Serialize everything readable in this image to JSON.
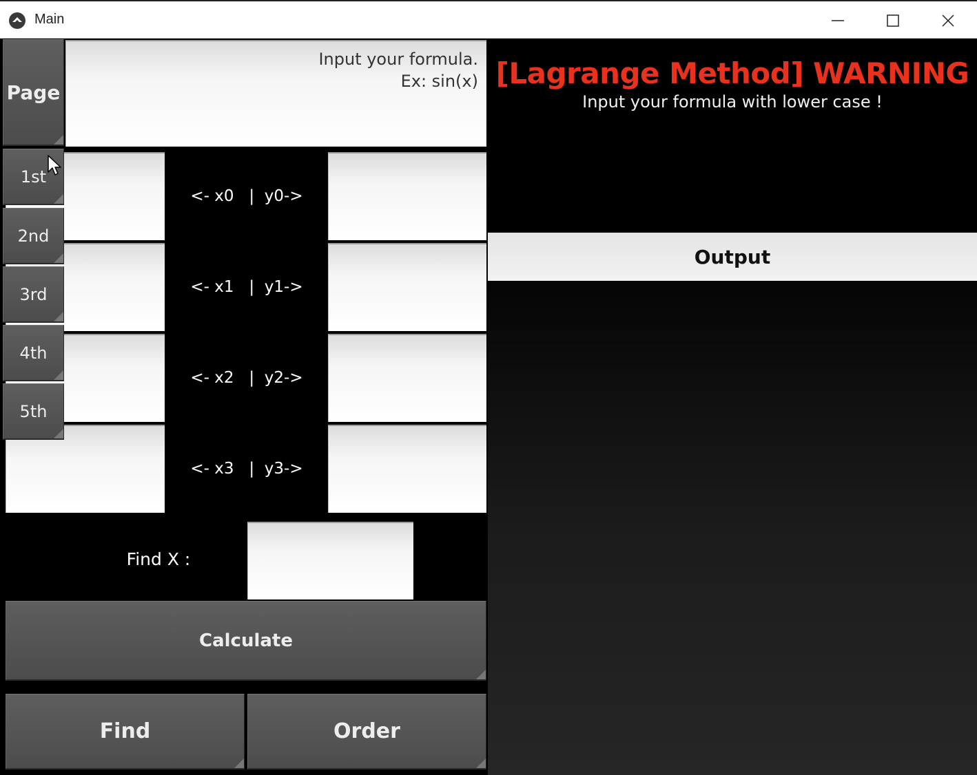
{
  "window": {
    "title": "Main",
    "icon": "kivy-logo-icon",
    "controls": [
      "minimize-icon",
      "maximize-icon",
      "close-icon"
    ]
  },
  "sidebar": {
    "page_label": "Page",
    "items": [
      {
        "label": "1st"
      },
      {
        "label": "2nd"
      },
      {
        "label": "3rd"
      },
      {
        "label": "4th"
      },
      {
        "label": "5th"
      }
    ]
  },
  "formula": {
    "placeholder_line1": "Input your formula.",
    "placeholder_line2": "Ex: sin(x)",
    "value": ""
  },
  "points": [
    {
      "label": "<- x0   |  y0->",
      "x_value": "",
      "y_value": ""
    },
    {
      "label": "<- x1   |  y1->",
      "x_value": "",
      "y_value": ""
    },
    {
      "label": "<- x2   |  y2->",
      "x_value": "",
      "y_value": ""
    },
    {
      "label": "<- x3   |  y3->",
      "x_value": "",
      "y_value": ""
    }
  ],
  "find_x": {
    "label": "Find X :",
    "value": ""
  },
  "actions": {
    "calculate": "Calculate",
    "find": "Find",
    "order": "Order"
  },
  "warning": {
    "title": "[Lagrange Method] WARNING",
    "subtitle": "Input your formula with lower case !",
    "title_color": "#e8321e"
  },
  "output": {
    "header": "Output",
    "text": ""
  }
}
